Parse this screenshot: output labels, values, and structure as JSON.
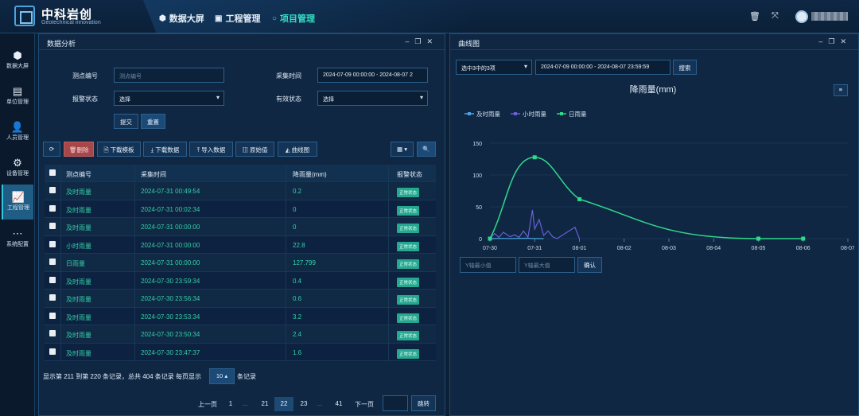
{
  "brand": {
    "name_cn": "中科岩创",
    "name_en": "Geotechnical innovation"
  },
  "topnav": [
    {
      "label": "数据大屏",
      "icon": "cube-icon"
    },
    {
      "label": "工程管理",
      "icon": "folder-icon"
    },
    {
      "label": "项目管理",
      "icon": "circle-icon",
      "active": true
    }
  ],
  "sidebar": {
    "items": [
      {
        "label": "数据大屏",
        "icon": "cube-icon"
      },
      {
        "label": "单位管理",
        "icon": "calendar-icon"
      },
      {
        "label": "人员管理",
        "icon": "user-icon"
      },
      {
        "label": "设备管理",
        "icon": "gear-icon"
      },
      {
        "label": "工程管理",
        "icon": "chart-icon",
        "active": true
      },
      {
        "label": "系统配置",
        "icon": "dots-icon"
      }
    ]
  },
  "left_panel": {
    "title": "数据分析",
    "form": {
      "point_label": "测点编号",
      "point_placeholder": "测点编号",
      "time_label": "采集时间",
      "time_value": "2024-07-09 00:00:00 - 2024-08-07 2",
      "alarm_label": "报警状态",
      "alarm_value": "选择",
      "valid_label": "有效状态",
      "valid_value": "选择",
      "submit": "提交",
      "reset": "重置"
    },
    "toolbar": {
      "refresh": "⟳",
      "delete": "删除",
      "download_template": "下载模板",
      "download_data": "下载数据",
      "import_data": "导入数据",
      "raw_value": "原始值",
      "curve_chart": "曲线图",
      "columns": "▦ ▾",
      "search": "🔍"
    },
    "table": {
      "headers": [
        "测点编号",
        "采集时间",
        "降雨量(mm)",
        "报警状态"
      ],
      "rows": [
        {
          "id": "及时雨量",
          "time": "2024-07-31 00:49:54",
          "value": "0.2",
          "status": "正常状态"
        },
        {
          "id": "及时雨量",
          "time": "2024-07-31 00:02:34",
          "value": "0",
          "status": "正常状态"
        },
        {
          "id": "及时雨量",
          "time": "2024-07-31 00:00:00",
          "value": "0",
          "status": "正常状态"
        },
        {
          "id": "小时雨量",
          "time": "2024-07-31 00:00:00",
          "value": "22.8",
          "status": "正常状态"
        },
        {
          "id": "日雨量",
          "time": "2024-07-31 00:00:00",
          "value": "127.799",
          "status": "正常状态"
        },
        {
          "id": "及时雨量",
          "time": "2024-07-30 23:59:34",
          "value": "0.4",
          "status": "正常状态"
        },
        {
          "id": "及时雨量",
          "time": "2024-07-30 23:56:34",
          "value": "0.6",
          "status": "正常状态"
        },
        {
          "id": "及时雨量",
          "time": "2024-07-30 23:53:34",
          "value": "3.2",
          "status": "正常状态"
        },
        {
          "id": "及时雨量",
          "time": "2024-07-30 23:50:34",
          "value": "2.4",
          "status": "正常状态"
        },
        {
          "id": "及时雨量",
          "time": "2024-07-30 23:47:37",
          "value": "1.6",
          "status": "正常状态"
        }
      ]
    },
    "footer": {
      "summary": "显示第 211 到第 220 条记录，总共 404 条记录 每页显示",
      "page_size": "10 ▴",
      "suffix": "条记录"
    },
    "pagination": {
      "prev": "上一页",
      "pages": [
        "1",
        "...",
        "21",
        "22",
        "23",
        "...",
        "41"
      ],
      "current": "22",
      "next": "下一页",
      "jump": "跳转"
    }
  },
  "right_panel": {
    "title": "曲线图",
    "select_value": "选中3中的3项",
    "time_range": "2024-07-09 00:00:00 - 2024-08-07 23:59:59",
    "search": "搜索",
    "ymin_placeholder": "Y轴最小值",
    "ymax_placeholder": "Y轴最大值",
    "confirm": "确认"
  },
  "chart_data": {
    "type": "line",
    "title": "降雨量(mm)",
    "xlabel": "",
    "ylabel": "",
    "ylim": [
      0,
      150
    ],
    "yticks": [
      0,
      50,
      100,
      150
    ],
    "xticks": [
      "07-30",
      "07-31",
      "08-01",
      "08-02",
      "08-03",
      "08-04",
      "08-05",
      "08-06",
      "08-07"
    ],
    "legend_position": "top-left",
    "grid": true,
    "series": [
      {
        "name": "及时雨量",
        "color": "#4aa3e0",
        "x": [
          0,
          0.2,
          0.5,
          0.8,
          1.0,
          1.2
        ],
        "values": [
          0,
          0.3,
          0.2,
          0.6,
          0.2,
          0
        ]
      },
      {
        "name": "小时雨量",
        "color": "#6a5fd6",
        "x": [
          0,
          0.1,
          0.2,
          0.3,
          0.45,
          0.55,
          0.65,
          0.75,
          0.85,
          0.95,
          1.0,
          1.1,
          1.2,
          1.3,
          1.4,
          1.5,
          1.9,
          2.0
        ],
        "values": [
          0,
          8,
          2,
          10,
          3,
          6,
          2,
          12,
          2,
          45,
          15,
          30,
          5,
          12,
          3,
          0,
          18,
          0
        ]
      },
      {
        "name": "日雨量",
        "color": "#2fd98b",
        "x": [
          0,
          1,
          2,
          6,
          7
        ],
        "values": [
          0,
          127.799,
          62,
          0,
          0
        ]
      }
    ]
  }
}
